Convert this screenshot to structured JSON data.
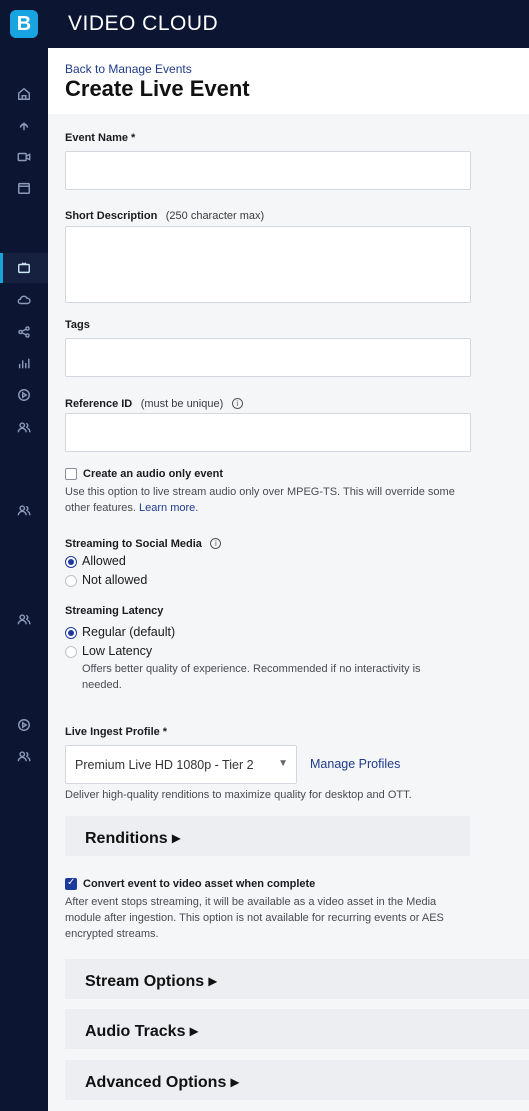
{
  "app": {
    "title": "VIDEO CLOUD",
    "logo_letter": "B"
  },
  "sidebar": {
    "icons": [
      "home-icon",
      "upload-icon",
      "video-camera-icon",
      "media-library-icon",
      "live-tv-icon",
      "cloud-icon",
      "share-icon",
      "analytics-icon",
      "player-icon",
      "users-icon",
      "users-icon-2",
      "users-icon-3",
      "player-icon-2",
      "users-icon-4"
    ]
  },
  "header": {
    "back_link": "Back to Manage Events",
    "page_title": "Create Live Event"
  },
  "form": {
    "event_name": {
      "label": "Event Name *",
      "value": ""
    },
    "short_description": {
      "label": "Short Description",
      "hint": "(250 character max)",
      "value": ""
    },
    "tags": {
      "label": "Tags",
      "value": ""
    },
    "reference_id": {
      "label": "Reference ID",
      "hint": "(must be unique)",
      "value": ""
    },
    "audio_only": {
      "label": "Create an audio only event",
      "help": "Use this option to live stream audio only over MPEG-TS. This will override some other features.",
      "learn_more": "Learn more.",
      "checked": false
    },
    "social_media": {
      "label": "Streaming to Social Media",
      "options": [
        "Allowed",
        "Not allowed"
      ],
      "selected": "Allowed"
    },
    "latency": {
      "label": "Streaming Latency",
      "options": [
        "Regular (default)",
        "Low Latency"
      ],
      "selected": "Regular (default)",
      "low_latency_help": "Offers better quality of experience. Recommended if no interactivity is needed."
    },
    "ingest_profile": {
      "label": "Live Ingest Profile *",
      "selected": "Premium Live HD 1080p - Tier 2",
      "manage_link": "Manage Profiles",
      "help": "Deliver high-quality renditions to maximize quality for desktop and OTT."
    },
    "renditions": {
      "title": "Renditions ▸"
    },
    "convert_asset": {
      "label": "Convert event to video asset when complete",
      "help": "After event stops streaming, it will be available as a video asset in the Media module after ingestion. This option is not available for recurring events or AES encrypted streams.",
      "checked": true
    },
    "sections": [
      "Stream Options ▸",
      "Audio Tracks ▸",
      "Advanced Options ▸"
    ]
  },
  "colors": {
    "nav_bg": "#0c1633",
    "accent": "#1c3a9c",
    "link": "#1f3b8a",
    "page_bg": "#f5f6f8"
  }
}
